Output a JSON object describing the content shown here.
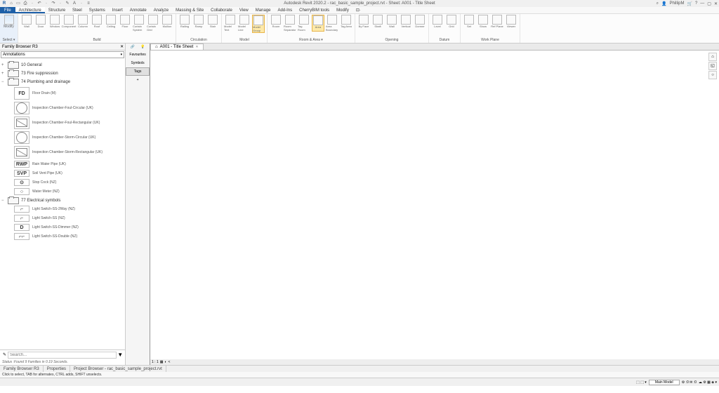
{
  "titlebar": {
    "doc_title": "Autodesk Revit 2020.2 - rac_basic_sample_project.rvt - Sheet: A001 - Title Sheet",
    "user": "PhillipM",
    "qa_icons": [
      "R",
      "⌂",
      "▭",
      "⎙",
      "·",
      "↶",
      "·",
      "↷",
      "·",
      "✎",
      "A",
      "·",
      "≡"
    ]
  },
  "ribbon_tabs": {
    "file": "File",
    "tabs": [
      "Architecture",
      "Structure",
      "Steel",
      "Systems",
      "Insert",
      "Annotate",
      "Analyze",
      "Massing & Site",
      "Collaborate",
      "View",
      "Manage",
      "Add-Ins",
      "CherryBIM tools",
      "Modify"
    ],
    "active": "Architecture",
    "extra": "⊡·"
  },
  "ribbon": {
    "select": {
      "label": "Modify",
      "panel": "Select ▾"
    },
    "build": {
      "panel": "Build",
      "btns": [
        "Wall",
        "Door",
        "Window",
        "Component",
        "Column",
        "Roof",
        "Ceiling",
        "Floor",
        "Curtain System",
        "Curtain Grid",
        "Mullion"
      ]
    },
    "circ": {
      "panel": "Circulation",
      "btns": [
        "Railing",
        "Ramp",
        "Stair"
      ]
    },
    "model": {
      "panel": "Model",
      "btns": [
        "Model Text",
        "Model Line",
        "Model Group"
      ],
      "highlight": 2
    },
    "room": {
      "panel": "Room & Area ▾",
      "btns": [
        "Room",
        "Room Separator",
        "Tag Room",
        "Area",
        "Area Boundary",
        "Tag Area"
      ],
      "highlight": 3
    },
    "open": {
      "panel": "Opening",
      "btns": [
        "By Face",
        "Shaft",
        "Wall",
        "Vertical",
        "Dormer"
      ]
    },
    "datum": {
      "panel": "Datum",
      "btns": [
        "Level",
        "Grid"
      ]
    },
    "work": {
      "panel": "Work Plane",
      "btns": [
        "Set",
        "Show",
        "Ref Plane",
        "Viewer"
      ]
    }
  },
  "family_browser": {
    "title": "Family Browser R3",
    "combo": "Annotations",
    "tools": {
      "tabs": [
        "Favourites",
        "Symbols",
        "Tags"
      ],
      "active": "Tags",
      "plus": "+"
    },
    "folders": [
      {
        "name": "10 General",
        "open": false
      },
      {
        "name": "73 Fire suppression",
        "open": false
      },
      {
        "name": "74 Plumbing and drainage",
        "open": true,
        "items": [
          {
            "thumb": "FD",
            "type": "text",
            "label": "Floor Drain (M)"
          },
          {
            "thumb": "",
            "type": "circ",
            "label": "Inspection Chamber-Foul-Circular (UK)"
          },
          {
            "thumb": "",
            "type": "rect",
            "label": "Inspection Chamber-Foul-Rectangular (UK)"
          },
          {
            "thumb": "",
            "type": "circ",
            "label": "Inspection Chamber-Storm-Circular (UK)"
          },
          {
            "thumb": "",
            "type": "rect",
            "label": "Inspection Chamber-Storm-Rectangular (UK)"
          },
          {
            "thumb": "RWP",
            "type": "text-sm",
            "label": "Rain Water Pipe (UK)"
          },
          {
            "thumb": "SVP",
            "type": "text-sm",
            "label": "Soil Vent Pipe (UK)"
          },
          {
            "thumb": "⊙",
            "type": "text-sm",
            "label": "Stop Cock (NZ)"
          },
          {
            "thumb": "○",
            "type": "text-sm",
            "label": "Water Meter (NZ)"
          }
        ]
      },
      {
        "name": "77 Electrical symbols",
        "open": true,
        "items": [
          {
            "thumb": "⌐",
            "type": "text-sm",
            "label": "Light Switch-SS-2Way (NZ)"
          },
          {
            "thumb": "⌐",
            "type": "text-sm",
            "label": "Light Switch-SS (NZ)"
          },
          {
            "thumb": "D",
            "type": "text-sm",
            "label": "Light Switch-SS-Dimmer (NZ)"
          },
          {
            "thumb": "⌐⌐",
            "type": "text-sm",
            "label": "Light Switch-SS-Double (NZ)"
          }
        ]
      }
    ],
    "search_placeholder": "Search...",
    "status": "Status :Found 9 Families in 0.19 Seconds."
  },
  "canvas": {
    "tab": {
      "icon": "⌂",
      "label": "A001 - Title Sheet"
    },
    "scrollinfo": "1 : 1"
  },
  "bottom_tabs": [
    "Family Browser R3",
    "Properties",
    "Project Browser - rac_basic_sample_project.rvt"
  ],
  "statusbar": {
    "hint": "Click to select, TAB for alternates, CTRL adds, SHIFT unselects.",
    "model_combo": "Main Model",
    "zeros": "⚙ :0  ✉ :0"
  }
}
